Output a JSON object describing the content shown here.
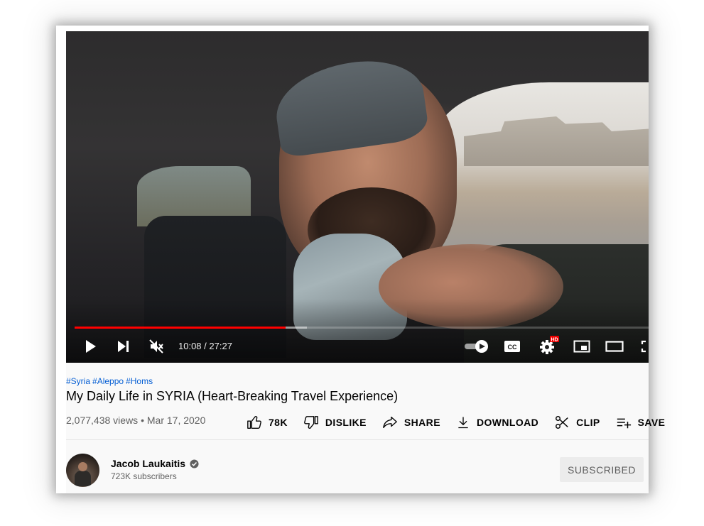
{
  "player": {
    "current_time": "10:08",
    "separator": " / ",
    "duration": "27:27",
    "played_fraction": 0.367,
    "buffered_fraction": 0.405,
    "muted": true,
    "autoplay_on": true,
    "hd_badge": "HD",
    "cc_label": "CC",
    "icons": [
      "play-icon",
      "next-icon",
      "mute-icon",
      "autoplay-toggle-icon",
      "captions-icon",
      "settings-icon",
      "miniplayer-icon",
      "theater-icon",
      "fullscreen-icon"
    ],
    "progress_color": "#ff0000"
  },
  "video": {
    "hashtags": [
      "#Syria",
      "#Aleppo",
      "#Homs"
    ],
    "title": "My Daily Life in SYRIA (Heart-Breaking Travel Experience)",
    "views": "2,077,438 views",
    "meta_separator": " • ",
    "date": "Mar 17, 2020"
  },
  "actions": {
    "like_count": "78K",
    "dislike_label": "DISLIKE",
    "share_label": "SHARE",
    "download_label": "DOWNLOAD",
    "clip_label": "CLIP",
    "save_label": "SAVE"
  },
  "channel": {
    "name": "Jacob Laukaitis",
    "subscribers": "723K subscribers",
    "subscribe_label": "SUBSCRIBED",
    "verified": true
  },
  "colors": {
    "link_blue": "#065fd4",
    "text_primary": "#030303",
    "text_secondary": "#606060",
    "subscribed_bg": "#ececec"
  }
}
